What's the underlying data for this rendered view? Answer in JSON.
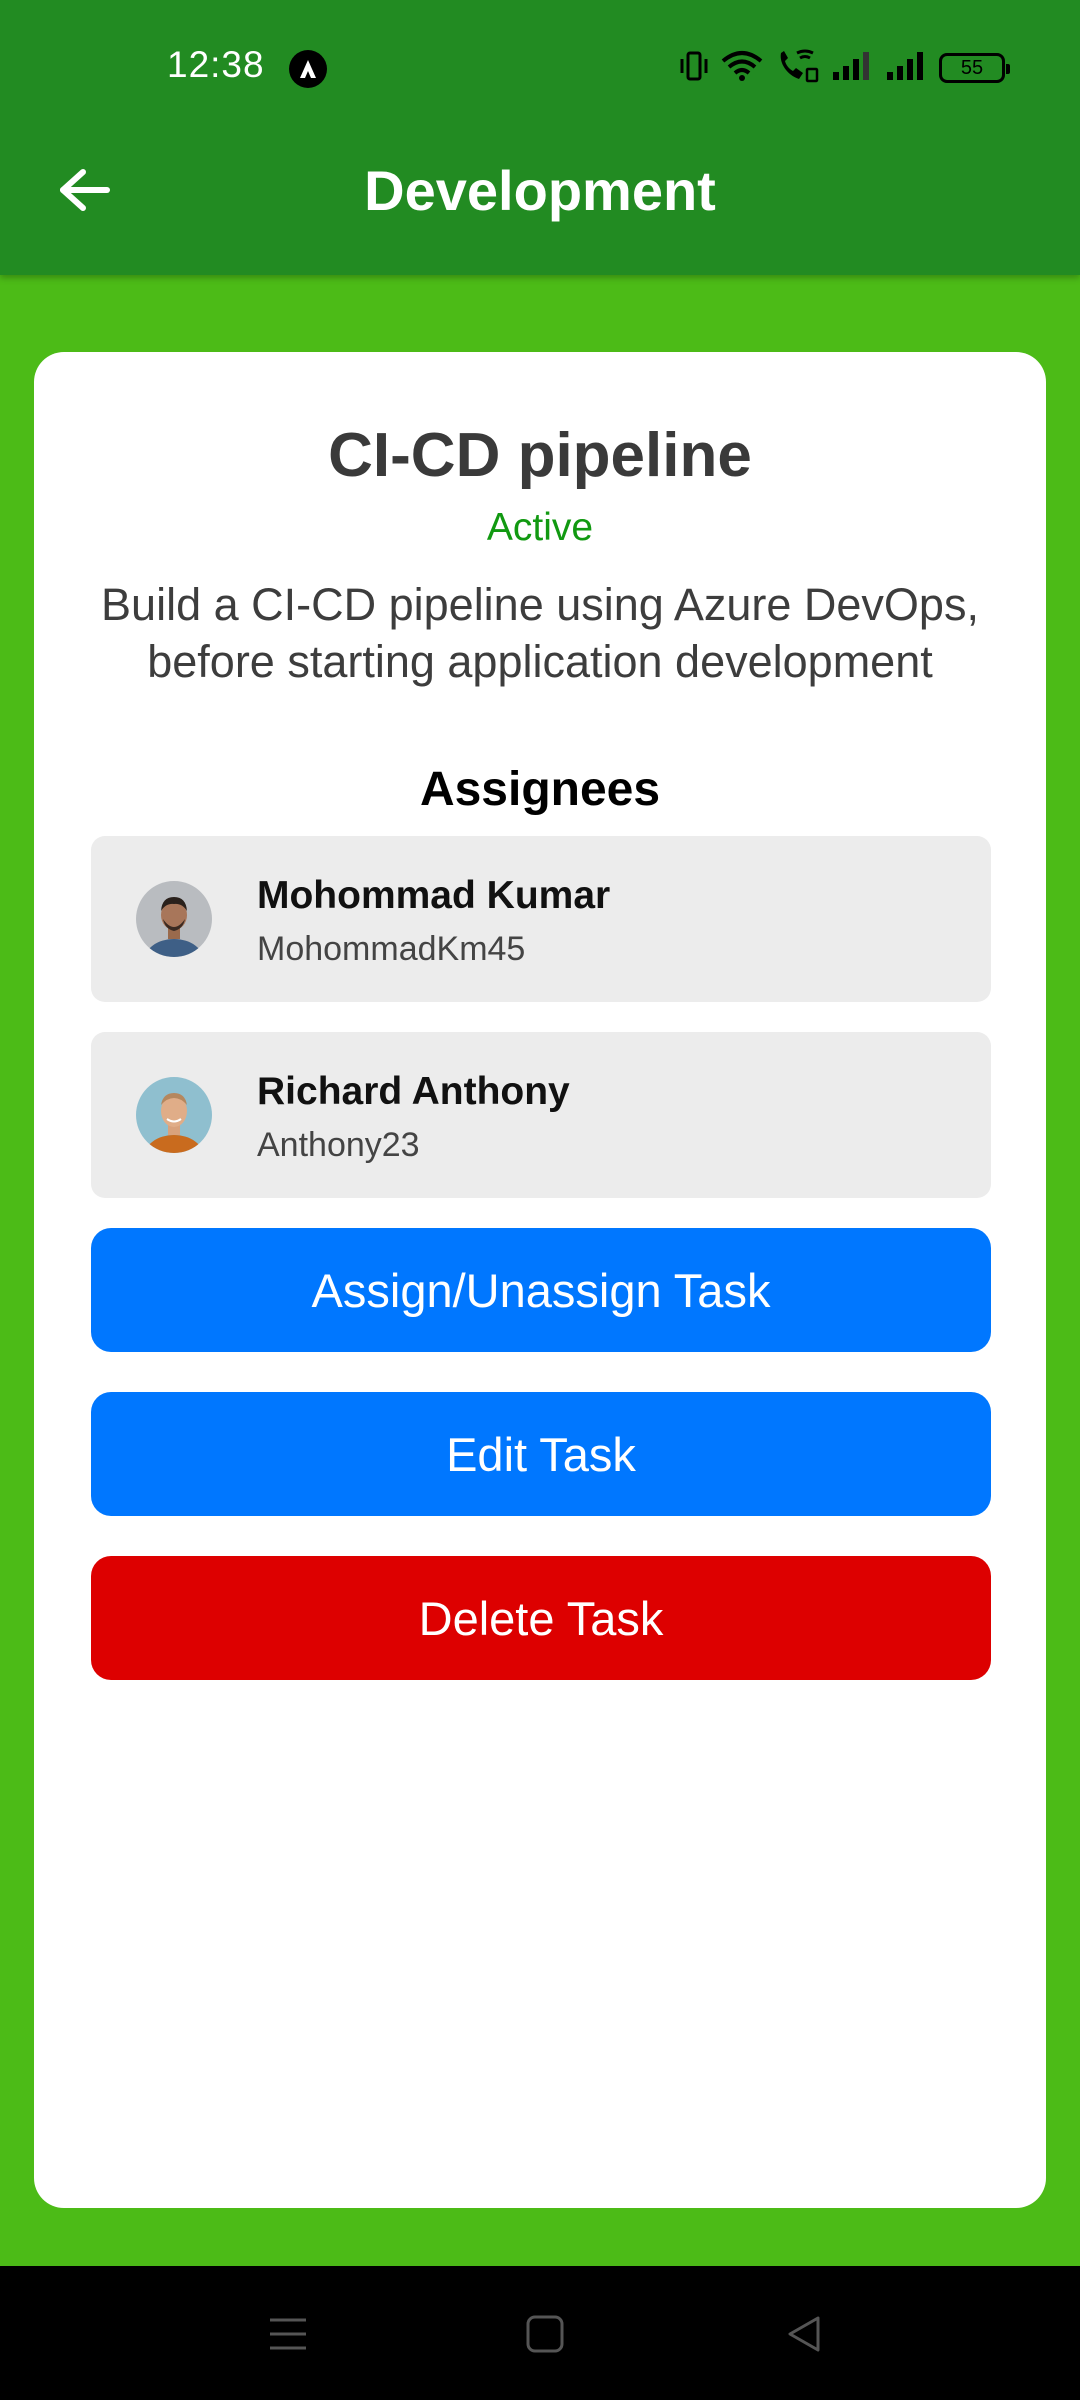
{
  "status_bar": {
    "time": "12:38",
    "battery_level": "55",
    "icons": [
      "app-notification-icon",
      "vibrate-icon",
      "wifi-icon",
      "wifi-call-icon",
      "signal-1-icon",
      "signal-2-icon",
      "battery-icon"
    ]
  },
  "app_bar": {
    "title": "Development",
    "back_icon": "arrow-left-icon"
  },
  "task": {
    "title": "CI-CD pipeline",
    "status": "Active",
    "description": "Build a CI-CD pipeline using Azure DevOps, before starting application development"
  },
  "assignees": {
    "heading": "Assignees",
    "items": [
      {
        "name": "Mohommad Kumar",
        "username": "MohommadKm45"
      },
      {
        "name": "Richard Anthony",
        "username": "Anthony23"
      }
    ]
  },
  "actions": {
    "assign_label": "Assign/Unassign Task",
    "edit_label": "Edit Task",
    "delete_label": "Delete Task"
  },
  "nav_bar": {
    "icons": [
      "menu-icon",
      "home-icon",
      "back-icon"
    ]
  },
  "colors": {
    "app_bar": "#228b22",
    "background": "#4cbb17",
    "status_active": "#119911",
    "primary_button": "#0077ff",
    "danger_button": "#dd0000"
  }
}
